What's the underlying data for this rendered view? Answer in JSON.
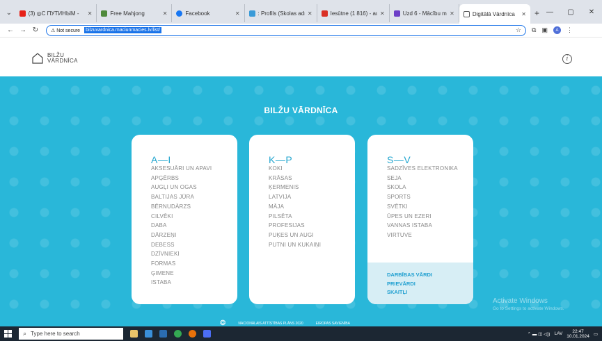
{
  "browser": {
    "tabs": [
      {
        "title": "(3) ◎С ПУТИНЫМ -",
        "color": "#e62117"
      },
      {
        "title": "Free Mahjong",
        "color": "#4f8a3c"
      },
      {
        "title": "Facebook",
        "color": "#1877f2"
      },
      {
        "title": ": Profils (Skolas adm",
        "color": "#3a9bd8"
      },
      {
        "title": "Iesūtne (1 816) - aus",
        "color": "#d93025"
      },
      {
        "title": "Uzd 6 - Mācību mat",
        "color": "#6d3fc7"
      },
      {
        "title": "Digitālā Vārdnīca",
        "color": "#555555"
      }
    ],
    "new_tab": "+",
    "window_controls": [
      "—",
      "▢",
      "✕"
    ],
    "security_label": "⚠ Not secure",
    "url": "bilzuvardnica.maciunmacies.lv/list/",
    "profile_initial": "A"
  },
  "site": {
    "logo_line1": "BILŽU",
    "logo_line2": "VĀRDNĪCA",
    "info_label": "i",
    "hero_title": "BILŽU VĀRDNĪCA"
  },
  "cards": [
    {
      "heading": "A—I",
      "items": [
        "AKSESUĀRI UN APAVI",
        "APĢĒRBS",
        "AUGĻI UN OGAS",
        "BALTIJAS JŪRA",
        "BĒRNUDĀRZS",
        "CILVĒKI",
        "DABA",
        "DĀRZEŅI",
        "DEBESS",
        "DZĪVNIEKI",
        "FORMAS",
        "ĢIMENE",
        "ISTABA"
      ]
    },
    {
      "heading": "K—P",
      "items": [
        "KOKI",
        "KRĀSAS",
        "ĶERMENIS",
        "LATVIJA",
        "MĀJA",
        "PILSĒTA",
        "PROFESIJAS",
        "PUĶES UN AUGI",
        "PUTNI UN KUKAIŅI"
      ]
    },
    {
      "heading": "S—V",
      "items": [
        "SADZĪVES ELEKTRONIKA",
        "SEJA",
        "SKOLA",
        "SPORTS",
        "SVĒTKI",
        "ŪPES UN EZERI",
        "VANNAS ISTABA",
        "VIRTUVE"
      ],
      "footer": [
        "DARBĪBAS VĀRDI",
        "PRIEVĀRDI",
        "SKAITĻI"
      ]
    }
  ],
  "footer_logos": [
    "NACIONĀLAIS ATTĪSTĪBAS PLĀNS 2020",
    "EIROPAS SAVIENĪBA"
  ],
  "watermark": {
    "title": "Activate Windows",
    "subtitle": "Go to Settings to activate Windows."
  },
  "taskbar": {
    "search_placeholder": "Type here to search",
    "time": "22:47",
    "date": "10.01.2024",
    "lang": "LAV"
  }
}
